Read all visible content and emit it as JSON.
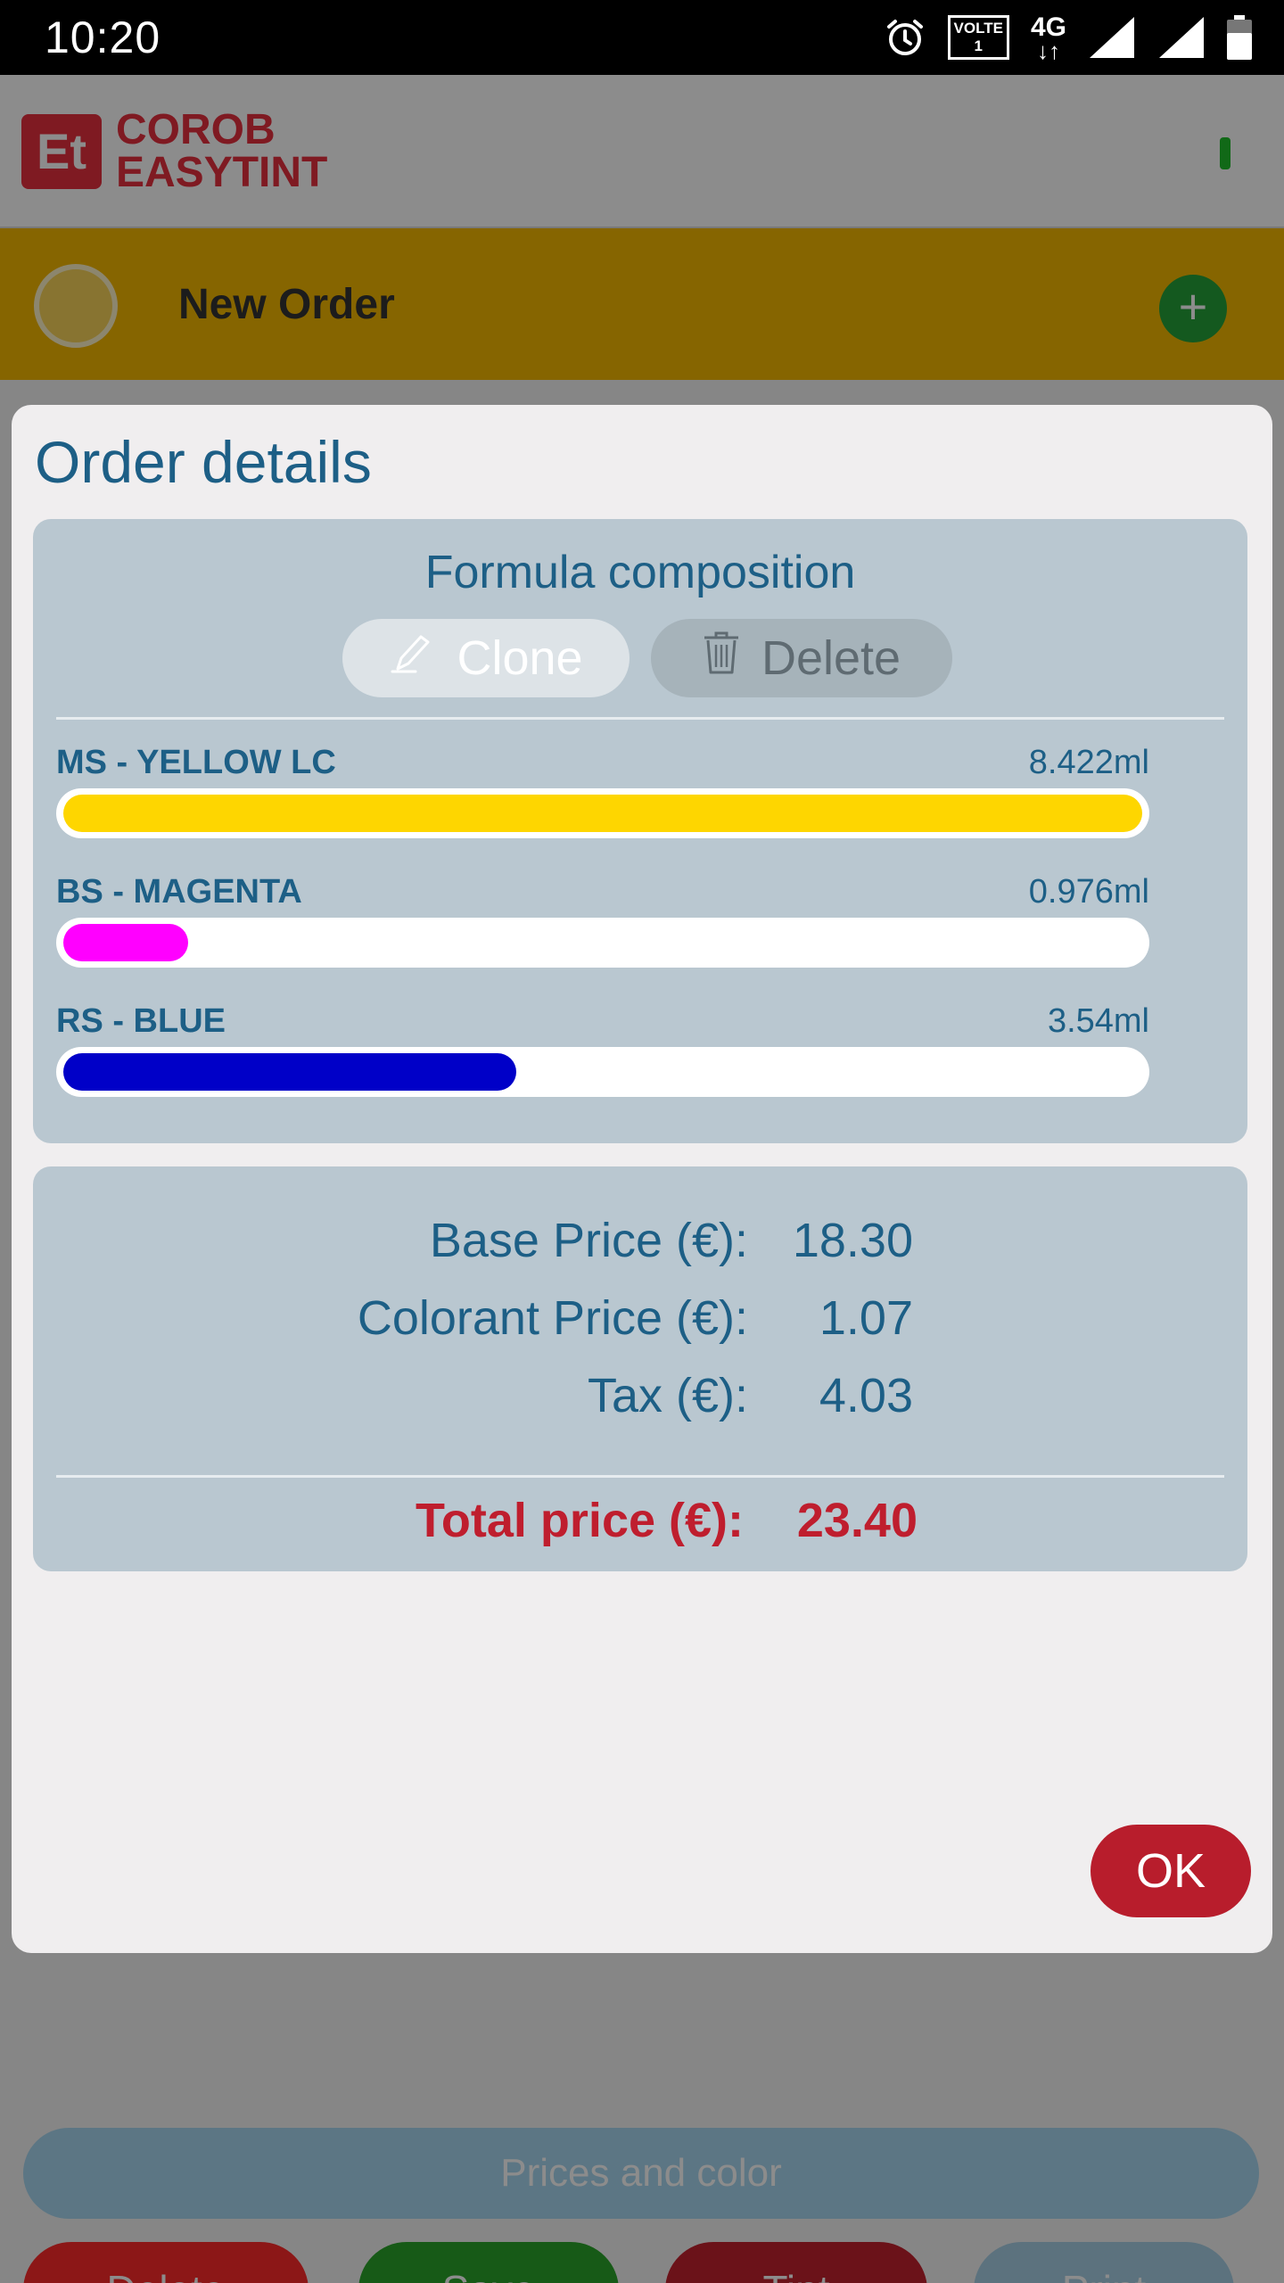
{
  "status_bar": {
    "time": "10:20",
    "volte_line1": "VOLTE",
    "volte_line2": "1",
    "network": "4G",
    "icons": [
      "alarm-icon",
      "volte-icon",
      "network-4g-icon",
      "signal-icon",
      "signal-icon",
      "battery-icon"
    ]
  },
  "background_app": {
    "brand_line1": "COROB",
    "brand_line2": "EASYTINT",
    "order_title": "New Order",
    "prices_button": "Prices and color",
    "buttons": {
      "delete": "Delete",
      "save": "Save",
      "tint": "Tint",
      "print": "Print"
    }
  },
  "dialog": {
    "title": "Order details",
    "formula": {
      "title": "Formula composition",
      "clone_label": "Clone",
      "delete_label": "Delete",
      "colorants": [
        {
          "name": "MS - YELLOW LC",
          "amount": "8.422ml",
          "fill_fraction": 1.0,
          "color": "#fed600"
        },
        {
          "name": "BS - MAGENTA",
          "amount": "0.976ml",
          "fill_fraction": 0.116,
          "color": "#ff00ff"
        },
        {
          "name": "RS - BLUE",
          "amount": "3.54ml",
          "fill_fraction": 0.42,
          "color": "#0000c8"
        }
      ]
    },
    "prices": {
      "base_label": "Base Price (€):",
      "base_value": "18.30",
      "colorant_label": "Colorant Price (€):",
      "colorant_value": "1.07",
      "tax_label": "Tax (€):",
      "tax_value": "4.03",
      "total_label": "Total price (€):",
      "total_value": "23.40"
    },
    "ok_label": "OK"
  },
  "colors": {
    "accent_blue": "#1d5f86",
    "total_red": "#bf1e2e",
    "ok_button": "#b81d2c",
    "order_bar": "#f4b800"
  }
}
